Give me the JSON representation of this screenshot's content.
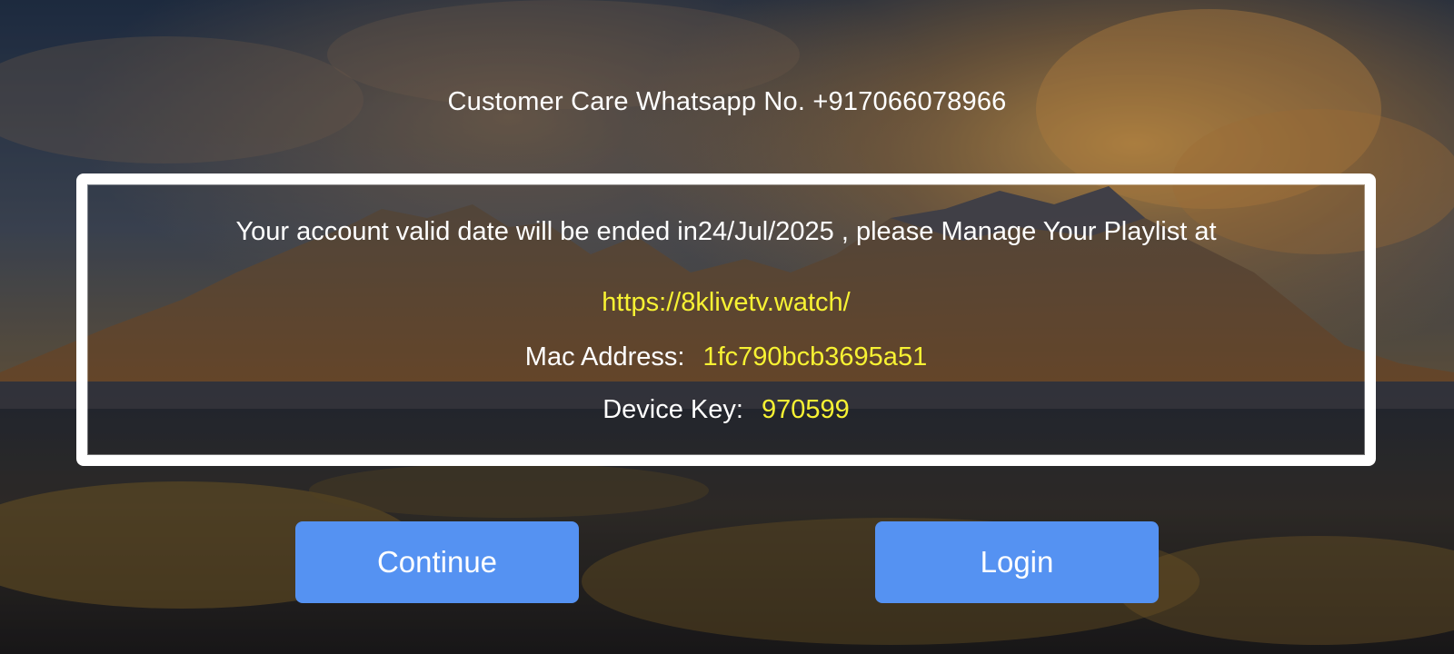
{
  "header": {
    "customer_care": "Customer Care Whatsapp No. +917066078966"
  },
  "account": {
    "message": "Your account valid date will be ended in24/Jul/2025 , please Manage Your Playlist at",
    "url": "https://8klivetv.watch/",
    "mac_label": "Mac Address:",
    "mac_value": "1fc790bcb3695a51",
    "key_label": "Device Key:",
    "key_value": "970599"
  },
  "buttons": {
    "continue_label": "Continue",
    "login_label": "Login"
  },
  "colors": {
    "accent_yellow": "#f7f233",
    "button_blue": "#5592f2",
    "box_border": "#ffffff"
  }
}
